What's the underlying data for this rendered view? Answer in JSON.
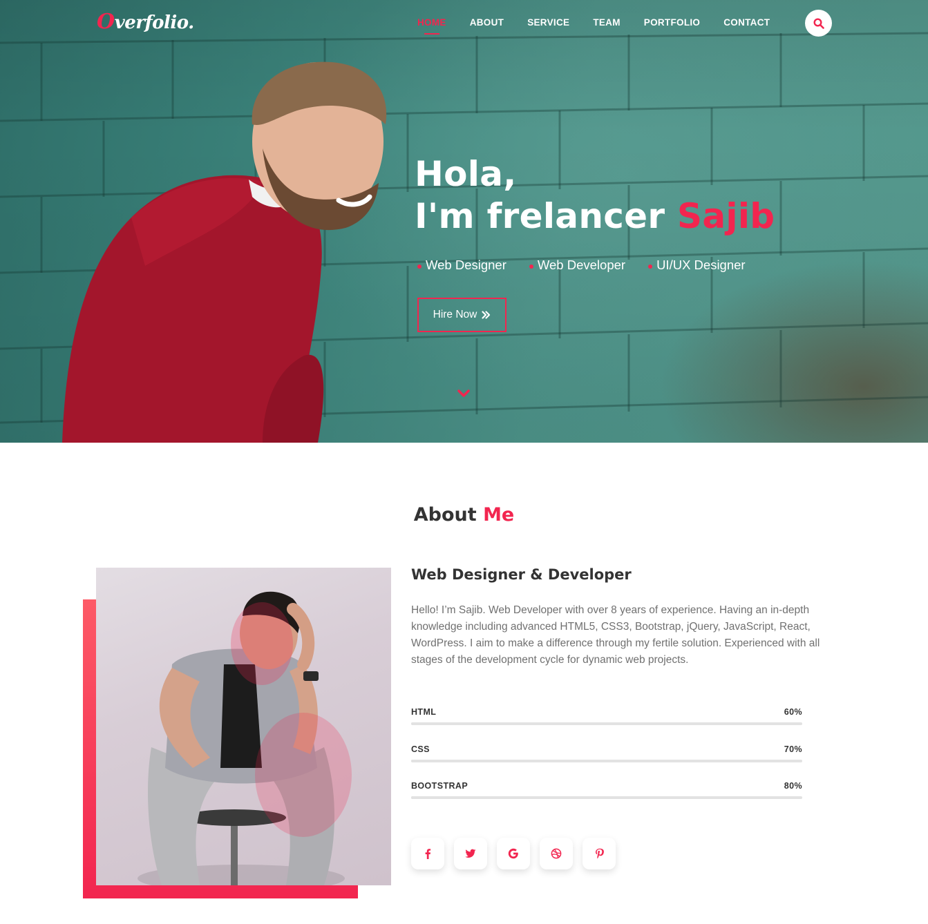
{
  "brand": {
    "logo_first": "O",
    "logo_rest": "verfolio."
  },
  "nav": {
    "items": [
      {
        "label": "HOME",
        "active": true
      },
      {
        "label": "ABOUT"
      },
      {
        "label": "SERVICE"
      },
      {
        "label": "TEAM"
      },
      {
        "label": "PORTFOLIO"
      },
      {
        "label": "CONTACT"
      }
    ],
    "search_icon": "search-icon"
  },
  "hero": {
    "greeting": "Hola,",
    "intro": "I'm frelancer ",
    "name": "Sajib",
    "roles": [
      "Web Designer",
      "Web Developer",
      "UI/UX Designer"
    ],
    "cta": "Hire Now",
    "cta_icon": "double-chevron-right-icon",
    "scroll_icon": "chevron-down-icon"
  },
  "about": {
    "title_part1": "About ",
    "title_part2": "Me",
    "subtitle": "Web Designer & Developer",
    "bio": "Hello! I’m Sajib. Web Developer with over 8 years of experience. Having an in-depth knowledge including advanced HTML5, CSS3, Bootstrap, jQuery, JavaScript, React, WordPress. I aim to make a difference through my fertile solution. Experienced with all stages of the development cycle for dynamic web projects.",
    "skills": [
      {
        "name": "HTML",
        "percent_label": "60%",
        "value": 60
      },
      {
        "name": "CSS",
        "percent_label": "70%",
        "value": 70
      },
      {
        "name": "BOOTSTRAP",
        "percent_label": "80%",
        "value": 80
      }
    ],
    "socials": [
      "facebook-icon",
      "twitter-icon",
      "google-icon",
      "dribbble-icon",
      "pinterest-icon"
    ]
  },
  "colors": {
    "accent": "#f2254f",
    "text": "#333333",
    "muted": "#707070",
    "hero_teal": "#3b827a"
  }
}
